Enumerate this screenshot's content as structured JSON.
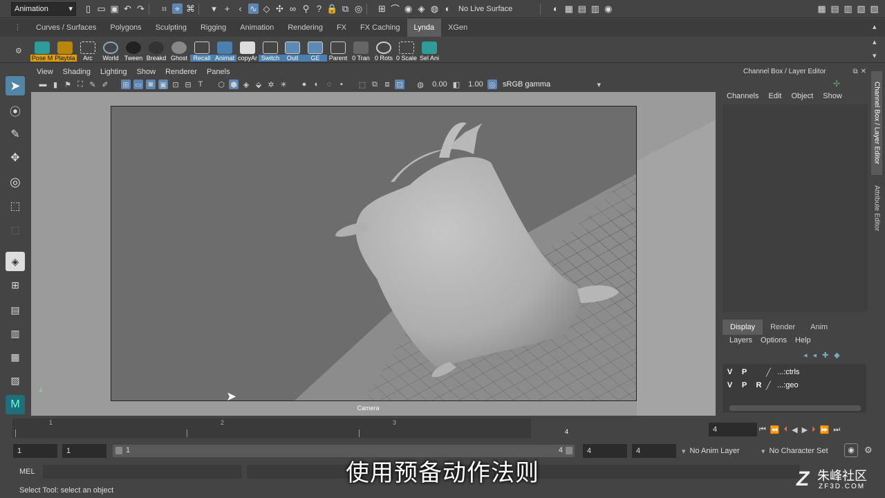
{
  "status_line": {
    "menu_set": "Animation",
    "live_surface": "No Live Surface"
  },
  "shelf_tabs": [
    "Curves / Surfaces",
    "Polygons",
    "Sculpting",
    "Rigging",
    "Animation",
    "Rendering",
    "FX",
    "FX Caching",
    "Lynda",
    "XGen"
  ],
  "active_shelf_tab": "Lynda",
  "shelf_buttons": [
    "Pose M",
    "Playbla",
    "Arc",
    "World",
    "Tween",
    "Breakd",
    "Ghost",
    "Recall",
    "Animat",
    "copyAr",
    "Switch",
    "Outl",
    "GE",
    "Parent",
    "0 Tran",
    "0 Rots",
    "0 Scale",
    "Sel Ani"
  ],
  "panel_menu": [
    "View",
    "Shading",
    "Lighting",
    "Show",
    "Renderer",
    "Panels"
  ],
  "panel_toolbar": {
    "exposure": "0.00",
    "gamma": "1.00",
    "color_space": "sRGB gamma"
  },
  "viewport": {
    "camera_label": "Camera"
  },
  "channel_box": {
    "title": "Channel Box / Layer Editor",
    "menu": [
      "Channels",
      "Edit",
      "Object",
      "Show"
    ]
  },
  "side_tabs": [
    "Channel Box / Layer Editor",
    "Attribute Editor"
  ],
  "layer_editor": {
    "tabs": [
      "Display",
      "Render",
      "Anim"
    ],
    "active_tab": "Display",
    "menu": [
      "Layers",
      "Options",
      "Help"
    ],
    "layers": [
      {
        "v": "V",
        "p": "P",
        "r": "",
        "name": "...:ctrls"
      },
      {
        "v": "V",
        "p": "P",
        "r": "R",
        "name": "...:geo"
      }
    ]
  },
  "time_slider": {
    "ticks": [
      "1",
      "2",
      "3",
      "4"
    ],
    "current_frame_marker": "4",
    "current_frame": "4"
  },
  "range_slider": {
    "anim_start": "1",
    "range_start": "1",
    "range_bar_start": "1",
    "range_bar_end": "4",
    "range_end": "4",
    "anim_end": "4",
    "anim_layer": "No Anim Layer",
    "character_set": "No Character Set"
  },
  "command_line": {
    "label": "MEL"
  },
  "help_line": "Select Tool: select an object",
  "subtitle": "使用预备动作法则",
  "watermark": {
    "name": "朱峰社区",
    "url": "ZF3D.COM"
  },
  "colors": {
    "accent": "#5285a6",
    "ui_bg": "#444444",
    "viewport_bg": "#9a9a9a",
    "model": "#b4b4b4"
  }
}
